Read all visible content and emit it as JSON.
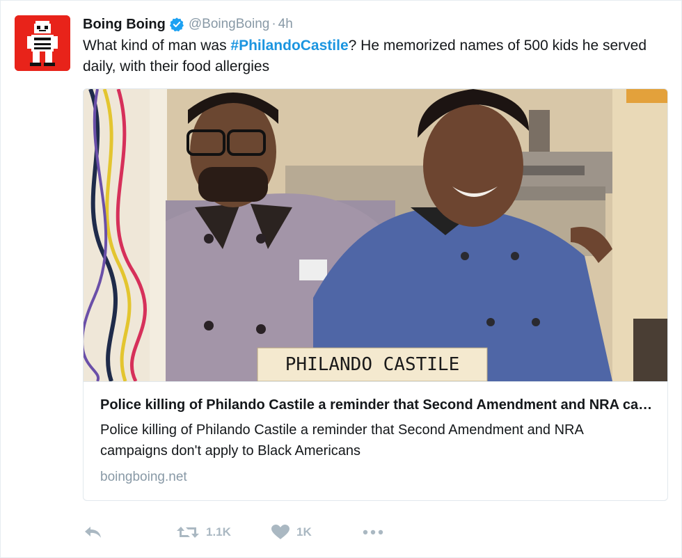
{
  "tweet": {
    "author_name": "Boing Boing",
    "handle": "@BoingBoing",
    "separator": "·",
    "time": "4h",
    "text_before": "What kind of man was ",
    "hashtag": "#PhilandoCastile",
    "text_after": "? He memorized names of 500 kids he served daily, with their food allergies"
  },
  "card": {
    "photo_caption": "PHILANDO CASTILE",
    "title": "Police killing of Philando Castile a reminder that Second Amendment and NRA campaigns don't apply to Black Americans",
    "description": "Police killing of Philando Castile a reminder that Second Amendment and NRA campaigns don't apply to Black Americans",
    "domain": "boingboing.net"
  },
  "actions": {
    "reply": {
      "icon": "reply-icon"
    },
    "retweet": {
      "icon": "retweet-icon",
      "count": "1.1K"
    },
    "like": {
      "icon": "heart-icon",
      "count": "1K"
    },
    "more": {
      "icon": "more-icon"
    }
  },
  "colors": {
    "link": "#1b95e0",
    "muted": "#8899a6",
    "action": "#aab8c2",
    "avatar_bg": "#e8231a"
  }
}
